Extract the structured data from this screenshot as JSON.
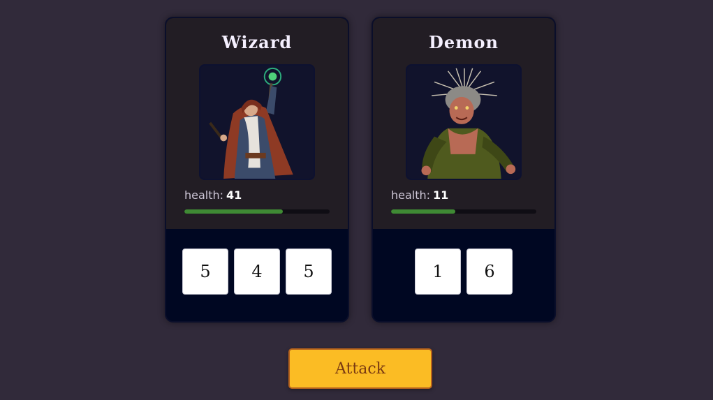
{
  "characters": [
    {
      "name": "Wizard",
      "health_label": "health:",
      "health": "41",
      "health_fraction": 0.68,
      "portrait": "wizard-portrait",
      "dice": [
        "5",
        "4",
        "5"
      ]
    },
    {
      "name": "Demon",
      "health_label": "health:",
      "health": "11",
      "health_fraction": 0.44,
      "portrait": "demon-portrait",
      "dice": [
        "1",
        "6"
      ]
    }
  ],
  "actions": {
    "attack_label": "Attack"
  },
  "colors": {
    "background": "#312a3a",
    "card_top": "#221d24",
    "dice_area": "#000722",
    "health_bar": "#3f8a34",
    "attack_button": "#fbbc24"
  }
}
